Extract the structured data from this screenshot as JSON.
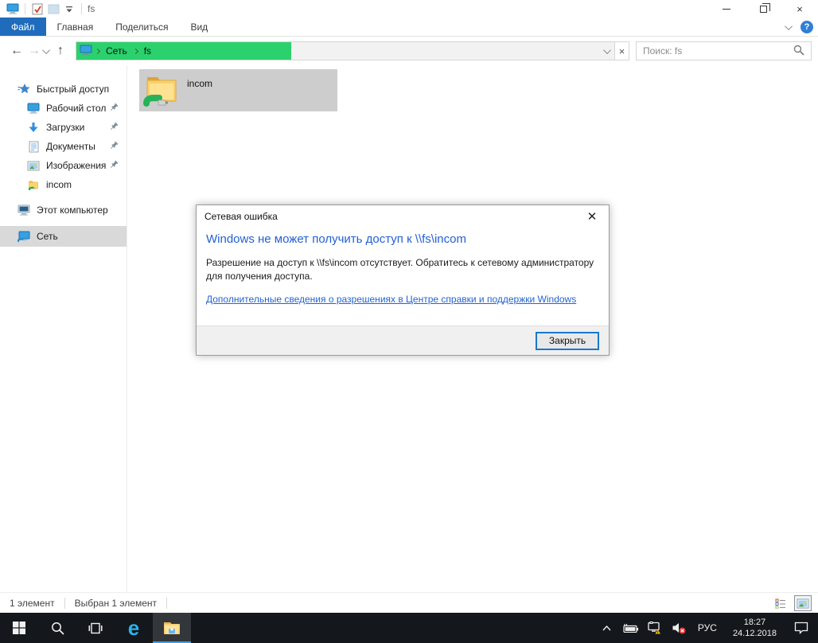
{
  "window": {
    "title": "fs"
  },
  "ribbon": {
    "tabs": [
      {
        "label": "Файл",
        "active": true
      },
      {
        "label": "Главная",
        "active": false
      },
      {
        "label": "Поделиться",
        "active": false
      },
      {
        "label": "Вид",
        "active": false
      }
    ]
  },
  "navbar": {
    "breadcrumb": {
      "items": [
        "Сеть",
        "fs"
      ]
    },
    "progress_percent": 40,
    "search_value": "Поиск: fs"
  },
  "sidebar": {
    "items": [
      {
        "label": "Быстрый доступ",
        "icon": "quick-access-star-icon",
        "pinned": false
      },
      {
        "label": "Рабочий стол",
        "icon": "desktop-icon",
        "pinned": true
      },
      {
        "label": "Загрузки",
        "icon": "downloads-icon",
        "pinned": true
      },
      {
        "label": "Документы",
        "icon": "documents-icon",
        "pinned": true
      },
      {
        "label": "Изображения",
        "icon": "pictures-icon",
        "pinned": true
      },
      {
        "label": "incom",
        "icon": "network-folder-icon",
        "pinned": false
      },
      {
        "label": "Этот компьютер",
        "icon": "this-pc-icon",
        "pinned": false
      },
      {
        "label": "Сеть",
        "icon": "network-icon",
        "pinned": false,
        "selected": true
      }
    ]
  },
  "content": {
    "items": [
      {
        "name": "incom",
        "icon": "network-folder-icon",
        "selected": true
      }
    ]
  },
  "dialog": {
    "title": "Сетевая ошибка",
    "heading": "Windows не может получить доступ к \\\\fs\\incom",
    "body": "Разрешение на доступ к \\\\fs\\incom отсутствует. Обратитесь к сетевому администратору для получения доступа.",
    "link": "Дополнительные сведения о разрешениях в Центре справки и поддержки Windows",
    "close_button": "Закрыть"
  },
  "statusbar": {
    "total": "1 элемент",
    "selected": "Выбран 1 элемент"
  },
  "taskbar": {
    "language": "РУС",
    "time": "18:27",
    "date": "24.12.2018"
  },
  "colors": {
    "progress_green": "#2bd16d",
    "active_tab_blue": "#1f6cbd",
    "heading_blue": "#2261d2",
    "link_blue": "#2264d0",
    "taskbar_bg": "#14171b",
    "taskbar_underline": "#3aa0e8",
    "warning_yellow": "#ffc20e",
    "mute_red": "#d93a3a"
  },
  "icons": {
    "quick_access": "star",
    "search": "magnifier",
    "tray": [
      "battery-icon",
      "network-warning-icon",
      "volume-muted-icon"
    ],
    "view_toggles": [
      "details-view-icon",
      "large-icons-view-icon"
    ]
  }
}
